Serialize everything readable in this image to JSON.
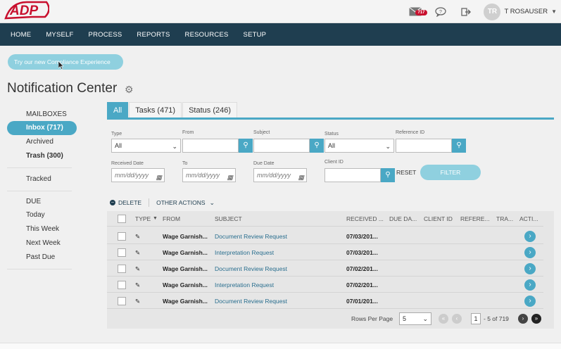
{
  "brand": {
    "logo_text": "ADP",
    "color": "#c8102e"
  },
  "topbar": {
    "mail_count": "717",
    "user_initials": "TR",
    "user_name": "T ROSAUSER"
  },
  "nav": [
    "HOME",
    "MYSELF",
    "PROCESS",
    "REPORTS",
    "RESOURCES",
    "SETUP"
  ],
  "promo": "Try our new Compliance Experience",
  "page_title": "Notification Center",
  "sidebar": {
    "mailboxes_header": "MAILBOXES",
    "inbox": "Inbox (717)",
    "archived": "Archived",
    "trash": "Trash (300)",
    "tracked": "Tracked",
    "due_header": "DUE",
    "today": "Today",
    "this_week": "This Week",
    "next_week": "Next Week",
    "past_due": "Past Due"
  },
  "tabs": {
    "all": "All",
    "tasks": "Tasks (471)",
    "status": "Status (246)"
  },
  "filters": {
    "type_label": "Type",
    "type_value": "All",
    "from_label": "From",
    "subject_label": "Subject",
    "status_label": "Status",
    "status_value": "All",
    "reference_label": "Reference ID",
    "received_label": "Received Date",
    "received_ph": "mm/dd/yyyy",
    "to_label": "To",
    "to_ph": "mm/dd/yyyy",
    "due_label": "Due Date",
    "due_ph": "mm/dd/yyyy",
    "client_label": "Client ID",
    "reset": "RESET",
    "filter": "FILTER"
  },
  "actions": {
    "delete": "DELETE",
    "other": "OTHER ACTIONS"
  },
  "table": {
    "headers": {
      "type": "TYPE",
      "from": "FROM",
      "subject": "SUBJECT",
      "received": "RECEIVED ...",
      "due": "DUE DA...",
      "client": "CLIENT ID",
      "reference": "REFERE...",
      "track": "TRA...",
      "action": "ACTI..."
    },
    "rows": [
      {
        "from": "Wage Garnish...",
        "subject": "Document Review Request",
        "received": "07/03/201..."
      },
      {
        "from": "Wage Garnish...",
        "subject": "Interpretation Request",
        "received": "07/03/201..."
      },
      {
        "from": "Wage Garnish...",
        "subject": "Document Review Request",
        "received": "07/02/201..."
      },
      {
        "from": "Wage Garnish...",
        "subject": "Interpretation Request",
        "received": "07/02/201..."
      },
      {
        "from": "Wage Garnish...",
        "subject": "Document Review Request",
        "received": "07/01/201..."
      }
    ]
  },
  "pager": {
    "rows_label": "Rows Per Page",
    "rows_value": "5",
    "page": "1",
    "range": "- 5  of  719"
  },
  "colors": {
    "nav": "#1f3e50",
    "accent": "#4aa8c5",
    "accent_light": "#8fd0df"
  }
}
